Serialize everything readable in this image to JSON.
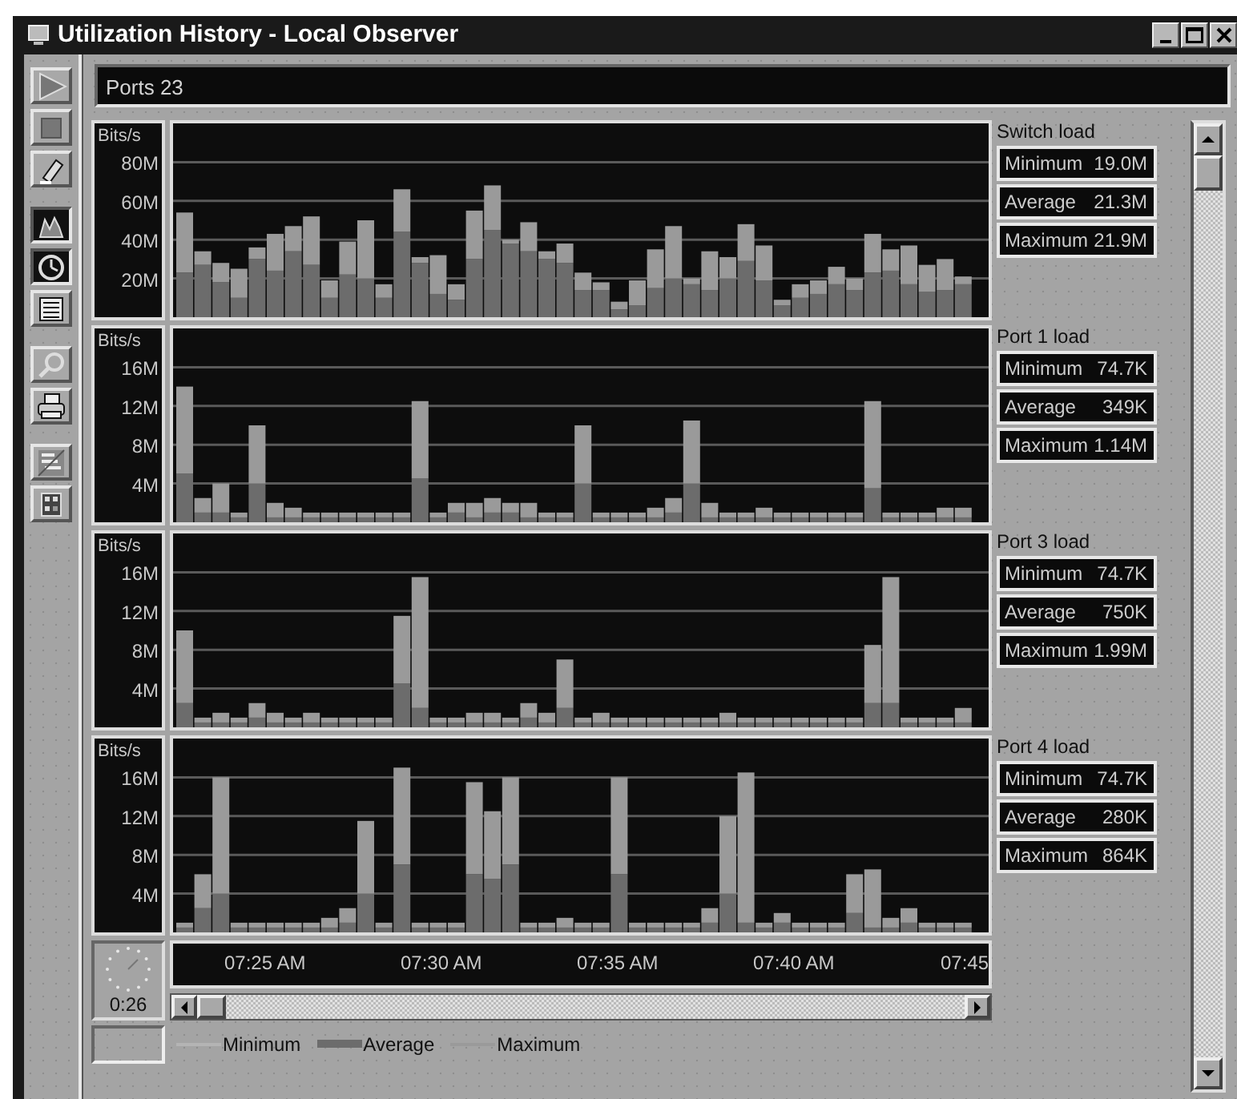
{
  "window": {
    "title": "Utilization History - Local Observer"
  },
  "toolbar": [
    {
      "pressed": false
    },
    {
      "pressed": false
    },
    {
      "pressed": false
    },
    {
      "pressed": true
    },
    {
      "pressed": true
    },
    {
      "pressed": false
    },
    {
      "pressed": false
    },
    {
      "pressed": false
    },
    {
      "pressed": false
    },
    {
      "pressed": false
    }
  ],
  "ports_field": {
    "value": "Ports 23"
  },
  "charts": [
    {
      "title": "Switch load",
      "stats": [
        {
          "label": "Minimum",
          "value": "19.0M"
        },
        {
          "label": "Average",
          "value": "21.3M"
        },
        {
          "label": "Maximum",
          "value": "21.9M"
        }
      ],
      "chart_data": {
        "type": "bar",
        "stacked": true,
        "grid": true,
        "ylabel": "Bits/s",
        "ylim": [
          0,
          100
        ],
        "yticks": [
          {
            "value": 20,
            "label": "20M"
          },
          {
            "value": 40,
            "label": "40M"
          },
          {
            "value": 60,
            "label": "60M"
          },
          {
            "value": 80,
            "label": "80M"
          }
        ],
        "series": [
          {
            "color": "#6c6c6c",
            "values": [
              23,
              27,
              18,
              10,
              30,
              24,
              34,
              27,
              10,
              22,
              20,
              10,
              44,
              28,
              12,
              9,
              30,
              45,
              38,
              34,
              30,
              28,
              14,
              14,
              4,
              6,
              15,
              20,
              17,
              14,
              20,
              29,
              19,
              6,
              10,
              12,
              17,
              14,
              23,
              24,
              17,
              13,
              14,
              17
            ]
          },
          {
            "color": "#9a9a9a",
            "values": [
              31,
              7,
              10,
              15,
              6,
              19,
              13,
              25,
              9,
              17,
              30,
              7,
              22,
              3,
              20,
              8,
              25,
              23,
              2,
              15,
              4,
              10,
              9,
              4,
              4,
              13,
              20,
              27,
              3,
              20,
              11,
              19,
              18,
              3,
              7,
              7,
              9,
              6,
              20,
              11,
              20,
              14,
              16,
              4
            ]
          }
        ]
      }
    },
    {
      "title": "Port 1 load",
      "stats": [
        {
          "label": "Minimum",
          "value": "74.7K"
        },
        {
          "label": "Average",
          "value": "349K"
        },
        {
          "label": "Maximum",
          "value": "1.14M"
        }
      ],
      "chart_data": {
        "type": "bar",
        "stacked": true,
        "grid": true,
        "ylabel": "Bits/s",
        "ylim": [
          0,
          20
        ],
        "yticks": [
          {
            "value": 4,
            "label": "4M"
          },
          {
            "value": 8,
            "label": "8M"
          },
          {
            "value": 12,
            "label": "12M"
          },
          {
            "value": 16,
            "label": "16M"
          }
        ],
        "series": [
          {
            "color": "#6c6c6c",
            "values": [
              5,
              1,
              1,
              0.5,
              4,
              0.5,
              0.5,
              0.5,
              0.5,
              0.5,
              0.5,
              0.5,
              0.5,
              4.5,
              0.5,
              1,
              0.5,
              1,
              1,
              0.5,
              0.5,
              0.5,
              4,
              0.5,
              0.5,
              0.5,
              0.5,
              1,
              4,
              0.5,
              0.5,
              0.5,
              0.5,
              0.5,
              0.5,
              0.5,
              0.5,
              0.5,
              3.5,
              0.5,
              0.5,
              0.5,
              0.5,
              0.5
            ]
          },
          {
            "color": "#9a9a9a",
            "values": [
              9,
              1.5,
              3,
              0.5,
              6,
              1.5,
              1,
              0.5,
              0.5,
              0.5,
              0.5,
              0.5,
              0.5,
              8,
              0.5,
              1,
              1.5,
              1.5,
              1,
              1.5,
              0.5,
              0.5,
              6,
              0.5,
              0.5,
              0.5,
              1,
              1.5,
              6.5,
              1.5,
              0.5,
              0.5,
              1,
              0.5,
              0.5,
              0.5,
              0.5,
              0.5,
              9,
              0.5,
              0.5,
              0.5,
              1,
              1
            ]
          }
        ]
      }
    },
    {
      "title": "Port 3 load",
      "stats": [
        {
          "label": "Minimum",
          "value": "74.7K"
        },
        {
          "label": "Average",
          "value": "750K"
        },
        {
          "label": "Maximum",
          "value": "1.99M"
        }
      ],
      "chart_data": {
        "type": "bar",
        "stacked": true,
        "grid": true,
        "ylabel": "Bits/s",
        "ylim": [
          0,
          20
        ],
        "yticks": [
          {
            "value": 4,
            "label": "4M"
          },
          {
            "value": 8,
            "label": "8M"
          },
          {
            "value": 12,
            "label": "12M"
          },
          {
            "value": 16,
            "label": "16M"
          }
        ],
        "series": [
          {
            "color": "#6c6c6c",
            "values": [
              2.5,
              0.5,
              0.5,
              0.5,
              1,
              0.5,
              0.5,
              0.5,
              0.5,
              0.5,
              0.5,
              0.5,
              4.5,
              2,
              0.5,
              0.5,
              0.5,
              0.5,
              0.5,
              1,
              0.5,
              2,
              0.5,
              0.5,
              0.5,
              0.5,
              0.5,
              0.5,
              0.5,
              0.5,
              0.5,
              0.5,
              0.5,
              0.5,
              0.5,
              0.5,
              0.5,
              0.5,
              2.5,
              2.5,
              0.5,
              0.5,
              0.5,
              0.5
            ]
          },
          {
            "color": "#9a9a9a",
            "values": [
              7.5,
              0.5,
              1,
              0.5,
              1.5,
              1,
              0.5,
              1,
              0.5,
              0.5,
              0.5,
              0.5,
              7,
              13.5,
              0.5,
              0.5,
              1,
              1,
              0.5,
              1.5,
              1,
              5,
              0.5,
              1,
              0.5,
              0.5,
              0.5,
              0.5,
              0.5,
              0.5,
              1,
              0.5,
              0.5,
              0.5,
              0.5,
              0.5,
              0.5,
              0.5,
              6,
              13,
              0.5,
              0.5,
              0.5,
              1.5
            ]
          }
        ]
      }
    },
    {
      "title": "Port 4 load",
      "stats": [
        {
          "label": "Minimum",
          "value": "74.7K"
        },
        {
          "label": "Average",
          "value": "280K"
        },
        {
          "label": "Maximum",
          "value": "864K"
        }
      ],
      "chart_data": {
        "type": "bar",
        "stacked": true,
        "grid": true,
        "ylabel": "Bits/s",
        "ylim": [
          0,
          20
        ],
        "yticks": [
          {
            "value": 4,
            "label": "4M"
          },
          {
            "value": 8,
            "label": "8M"
          },
          {
            "value": 12,
            "label": "12M"
          },
          {
            "value": 16,
            "label": "16M"
          }
        ],
        "series": [
          {
            "color": "#6c6c6c",
            "values": [
              0.5,
              2.5,
              4,
              0.5,
              0.5,
              0.5,
              0.5,
              0.5,
              0.5,
              1,
              4,
              0.5,
              7,
              0.5,
              0.5,
              0.5,
              6,
              5.5,
              7,
              0.5,
              0.5,
              0.5,
              0.5,
              0.5,
              6,
              0.5,
              0.5,
              0.5,
              0.5,
              1,
              4,
              1,
              0.5,
              1,
              0.5,
              0.5,
              0.5,
              2,
              0.5,
              0.5,
              1,
              0.5,
              0.5,
              0.5
            ]
          },
          {
            "color": "#9a9a9a",
            "values": [
              0.5,
              3.5,
              12,
              0.5,
              0.5,
              0.5,
              0.5,
              0.5,
              1,
              1.5,
              7.5,
              0.5,
              10,
              0.5,
              0.5,
              0.5,
              9.5,
              7,
              9,
              0.5,
              0.5,
              1,
              0.5,
              0.5,
              10,
              0.5,
              0.5,
              0.5,
              0.5,
              1.5,
              8,
              15.5,
              0.5,
              1,
              0.5,
              0.5,
              0.5,
              4,
              6,
              1,
              1.5,
              0.5,
              0.5,
              0.5
            ]
          }
        ]
      }
    }
  ],
  "timeline": {
    "elapsed": "0:26",
    "labels": [
      "07:25 AM",
      "07:30 AM",
      "07:35 AM",
      "07:40 AM",
      "07:45"
    ]
  },
  "legend": [
    {
      "label": "Minimum",
      "color": "#b4b4b4"
    },
    {
      "label": "Average",
      "color": "#6c6c6c"
    },
    {
      "label": "Maximum",
      "color": "#9a9a9a"
    }
  ]
}
